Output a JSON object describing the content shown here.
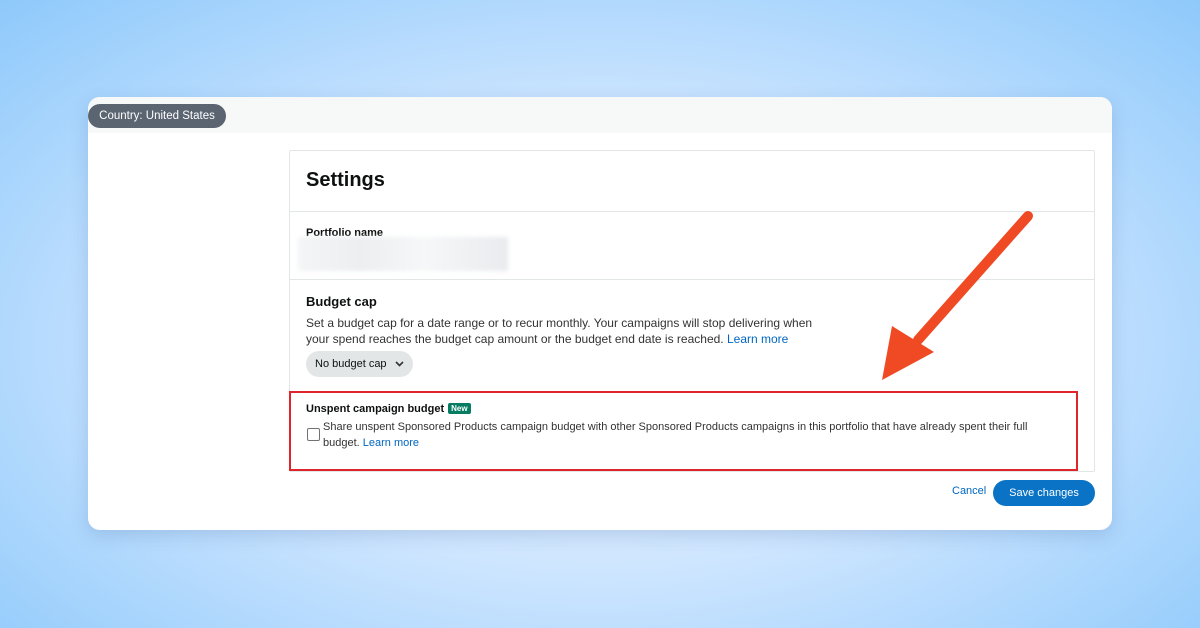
{
  "header": {
    "country_label": "Country: United States"
  },
  "settings": {
    "title": "Settings",
    "portfolio_name": {
      "label": "Portfolio name"
    },
    "budget_cap": {
      "heading": "Budget cap",
      "description": "Set a budget cap for a date range or to recur monthly. Your campaigns will stop delivering when your spend reaches the budget cap amount or the budget end date is reached.",
      "learn_more": "Learn more",
      "dropdown_value": "No budget cap"
    },
    "unspent_budget": {
      "heading": "Unspent campaign budget",
      "badge": "New",
      "checkbox_label": "Share unspent Sponsored Products campaign budget with other Sponsored Products campaigns in this portfolio that have already spent their full budget.",
      "learn_more": "Learn more",
      "checked": false
    }
  },
  "actions": {
    "cancel": "Cancel",
    "save": "Save changes"
  },
  "icons": {
    "dropdown": "chevron-down-icon",
    "annotation": "arrow-icon"
  },
  "colors": {
    "primary_button": "#0a73c5",
    "link": "#0066c0",
    "highlight_border": "#e0242b",
    "annotation_arrow": "#f04a24",
    "badge": "#067d62"
  }
}
